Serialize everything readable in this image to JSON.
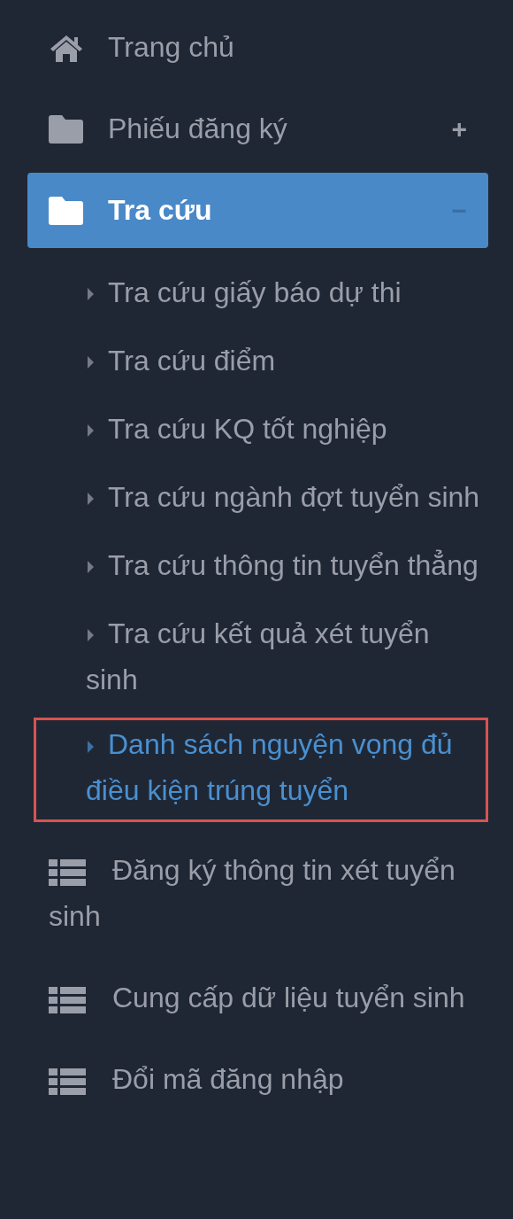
{
  "menu": [
    {
      "kind": "home",
      "label": "Trang chủ",
      "selected": false
    },
    {
      "kind": "folder",
      "label": "Phiếu đăng ký",
      "toggle": "+",
      "selected": false
    },
    {
      "kind": "folder",
      "label": "Tra cứu",
      "toggle": "−",
      "selected": true,
      "children": [
        {
          "label": "Tra cứu giấy báo dự thi",
          "selected": false,
          "outlined": false
        },
        {
          "label": "Tra cứu điểm",
          "selected": false,
          "outlined": false
        },
        {
          "label": "Tra cứu KQ tốt nghiệp",
          "selected": false,
          "outlined": false
        },
        {
          "label": "Tra cứu ngành đợt tuyển sinh",
          "selected": false,
          "outlined": false
        },
        {
          "label": "Tra cứu thông tin tuyển thẳng",
          "selected": false,
          "outlined": false
        },
        {
          "label": "Tra cứu kết quả xét tuyển sinh",
          "selected": false,
          "outlined": false
        },
        {
          "label": "Danh sách nguyện vọng đủ điều kiện trúng tuyển",
          "selected": true,
          "outlined": true
        }
      ]
    },
    {
      "kind": "list",
      "label": "Đăng ký thông tin xét tuyển sinh",
      "selected": false
    },
    {
      "kind": "list",
      "label": "Cung cấp dữ liệu tuyển sinh",
      "selected": false
    },
    {
      "kind": "list",
      "label": "Đổi mã đăng nhập",
      "selected": false
    }
  ]
}
